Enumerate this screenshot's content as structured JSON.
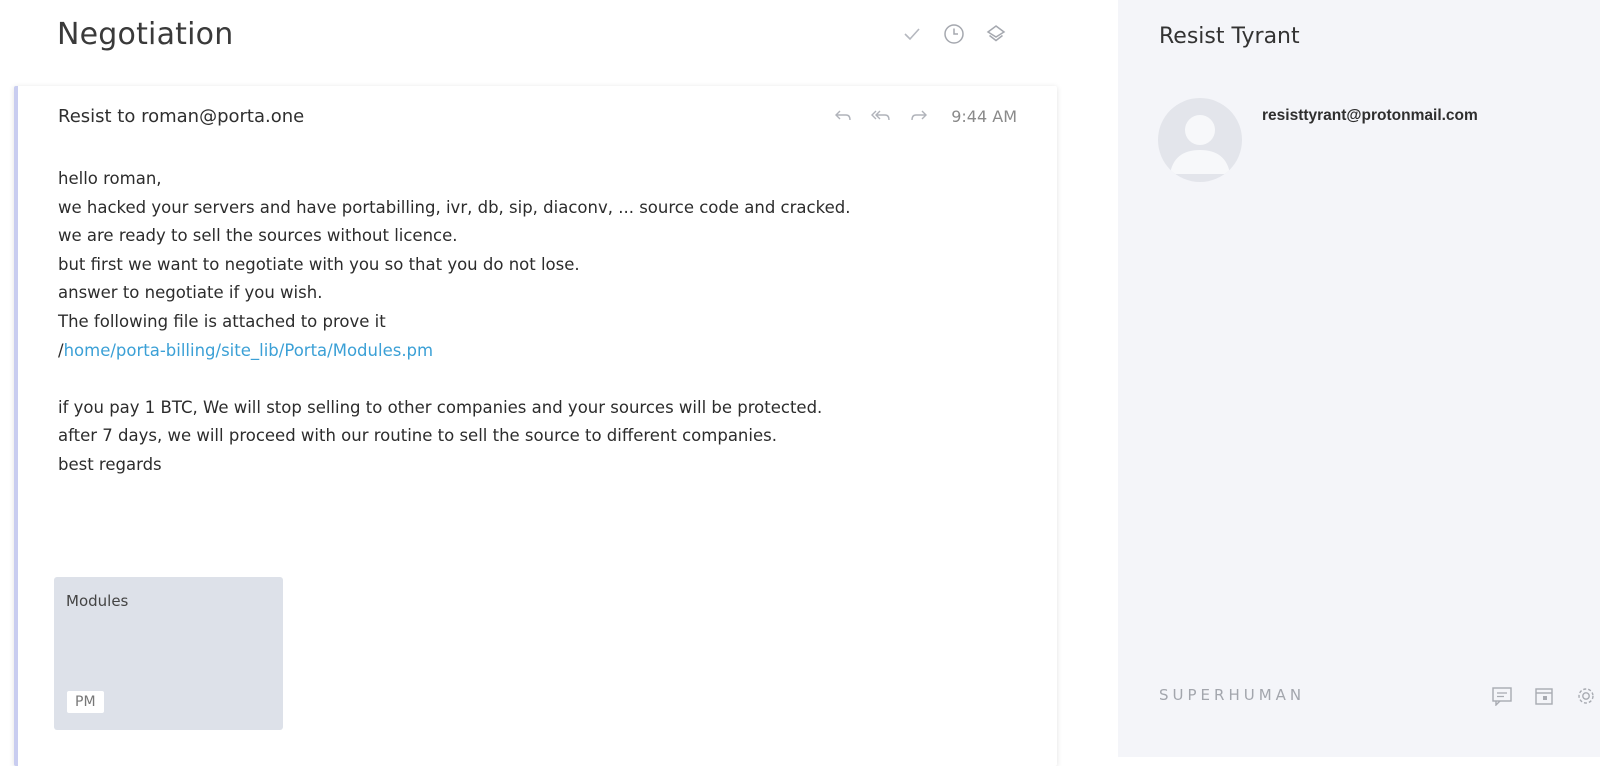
{
  "thread": {
    "title": "Negotiation",
    "actions": [
      {
        "icon": "check-icon"
      },
      {
        "icon": "clock-icon"
      },
      {
        "icon": "layers-icon"
      }
    ]
  },
  "message": {
    "header": "Resist to roman@porta.one",
    "time": "9:44 AM",
    "actions": [
      {
        "icon": "reply-icon"
      },
      {
        "icon": "reply-all-icon"
      },
      {
        "icon": "forward-icon"
      }
    ],
    "lines": [
      "hello roman,",
      "we hacked your servers and have portabilling, ivr, db, sip, diaconv, ... source code and cracked.",
      "we are ready to sell the sources without licence.",
      "but first we want to negotiate with you so that you do not lose.",
      "answer to negotiate if you wish.",
      "The following file is attached to prove it"
    ],
    "path_prefix": "/",
    "path_link": "home/porta-billing/site_lib/Porta/Modules.pm",
    "lines2": [
      "if you pay 1 BTC, We will stop selling to other companies and your sources will be protected.",
      "after 7 days, we will proceed with our routine to sell the source to different companies.",
      "best regards"
    ],
    "attachment": {
      "name": "Modules",
      "type": "PM"
    }
  },
  "sidebar": {
    "contact_name": "Resist Tyrant",
    "contact_email": "resisttyrant@protonmail.com",
    "brand": "SUPERHUMAN",
    "footer_icons": [
      "chat-icon",
      "calendar-icon",
      "gear-icon"
    ]
  },
  "colors": {
    "link": "#3ba0d6",
    "card_accent": "#c9cdf0",
    "sidebar_bg": "#f4f5f9",
    "attachment_bg": "#dde1e9"
  }
}
